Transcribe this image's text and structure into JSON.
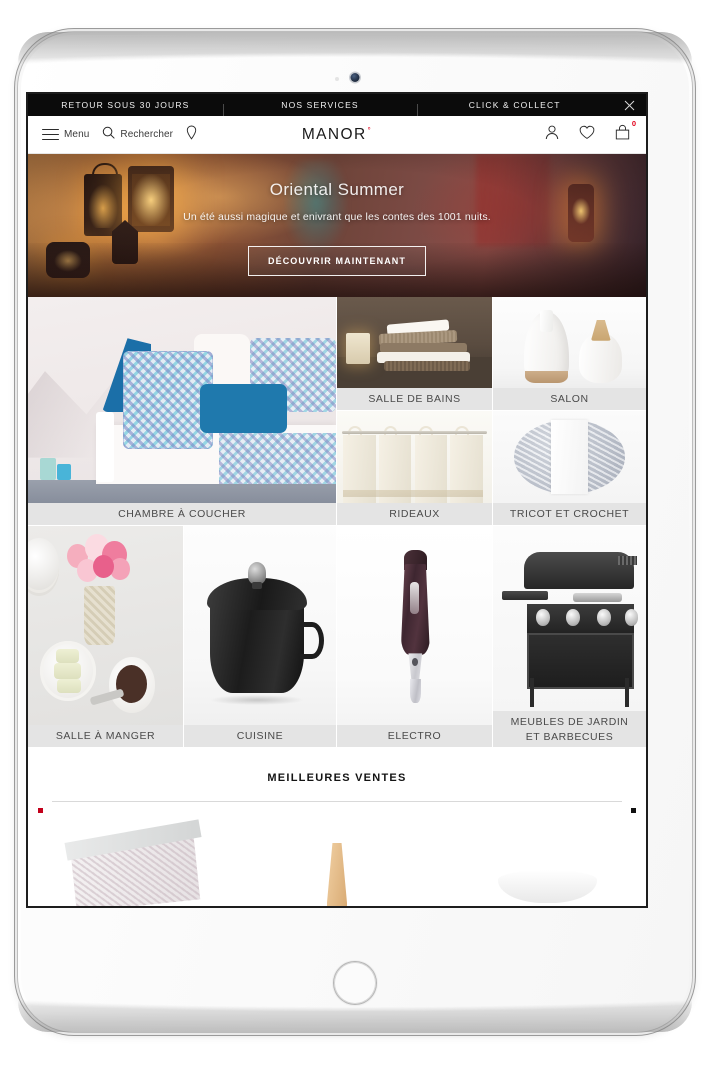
{
  "device": {
    "name": "tablet-frame"
  },
  "topbar": {
    "items": [
      {
        "label": "RETOUR SOUS 30 JOURS"
      },
      {
        "label": "NOS SERVICES"
      },
      {
        "label": "CLICK & COLLECT"
      }
    ],
    "close_icon": "close-icon"
  },
  "header": {
    "menu_label": "Menu",
    "menu_icon": "hamburger-icon",
    "search_label": "Rechercher",
    "search_icon": "search-icon",
    "store_icon": "location-pin-icon",
    "logo_text": "MANOR",
    "logo_mark": "°",
    "account_icon": "user-icon",
    "wishlist_icon": "heart-icon",
    "cart_icon": "bag-icon",
    "cart_count": "0"
  },
  "hero": {
    "title": "Oriental Summer",
    "subtitle": "Un été aussi magique et enivrant que les contes des 1001 nuits.",
    "cta_label": "DÉCOUVRIR MAINTENANT"
  },
  "categories": [
    {
      "label": "CHAMBRE À COUCHER",
      "art": "bedroom"
    },
    {
      "label": "SALLE DE BAINS",
      "art": "bathroom"
    },
    {
      "label": "SALON",
      "art": "living-room"
    },
    {
      "label": "RIDEAUX",
      "art": "curtains"
    },
    {
      "label": "TRICOT ET CROCHET",
      "art": "knitting"
    },
    {
      "label": "SALLE À MANGER",
      "art": "dining-room"
    },
    {
      "label": "CUISINE",
      "art": "kitchen"
    },
    {
      "label": "ELECTRO",
      "art": "electro"
    },
    {
      "label_line1": "MEUBLES DE JARDIN",
      "label_line2": "ET BARBECUES",
      "art": "garden-bbq"
    }
  ],
  "bestsellers": {
    "title": "MEILLEURES VENTES",
    "prev_icon": "carousel-prev-arrow",
    "next_icon": "carousel-next-arrow"
  },
  "colors": {
    "brand_red": "#e3001b",
    "topbar_bg": "#0b0b0b",
    "caption_bg": "#e4e4e4",
    "text_dark": "#1a1a1a"
  }
}
